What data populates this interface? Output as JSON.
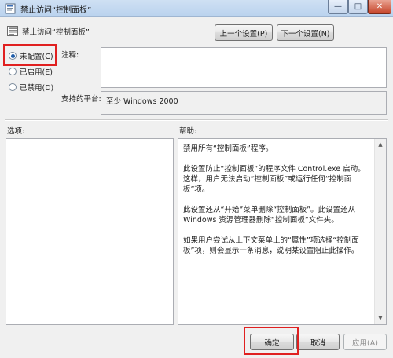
{
  "window": {
    "title": "禁止访问“控制面板”",
    "controls": {
      "minimize": "—",
      "maximize": "□",
      "close": "✕"
    }
  },
  "policy": {
    "name": "禁止访问“控制面板”"
  },
  "nav": {
    "prev_label": "上一个设置(P)",
    "next_label": "下一个设置(N)"
  },
  "state": {
    "selected": "not_configured",
    "options": [
      {
        "id": "not_configured",
        "label": "未配置(C)"
      },
      {
        "id": "enabled",
        "label": "已启用(E)"
      },
      {
        "id": "disabled",
        "label": "已禁用(D)"
      }
    ]
  },
  "comment": {
    "label": "注释:",
    "value": ""
  },
  "platform": {
    "label": "支持的平台:",
    "value": "至少 Windows 2000"
  },
  "options_pane": {
    "label": "选项:"
  },
  "help_pane": {
    "label": "帮助:",
    "paragraphs": [
      "禁用所有“控制面板”程序。",
      "此设置防止“控制面板”的程序文件 Control.exe 启动。这样，用户无法启动“控制面板”或运行任何“控制面板”项。",
      "此设置还从“开始”菜单删除“控制面板”。此设置还从 Windows 资源管理器删除“控制面板”文件夹。",
      "如果用户尝试从上下文菜单上的“属性”项选择“控制面板”项，则会显示一条消息，说明某设置阻止此操作。"
    ]
  },
  "footer": {
    "ok_label": "确定",
    "cancel_label": "取消",
    "apply_label": "应用(A)"
  },
  "colors": {
    "highlight": "#e02020",
    "titlebar": "#bad2ee"
  }
}
